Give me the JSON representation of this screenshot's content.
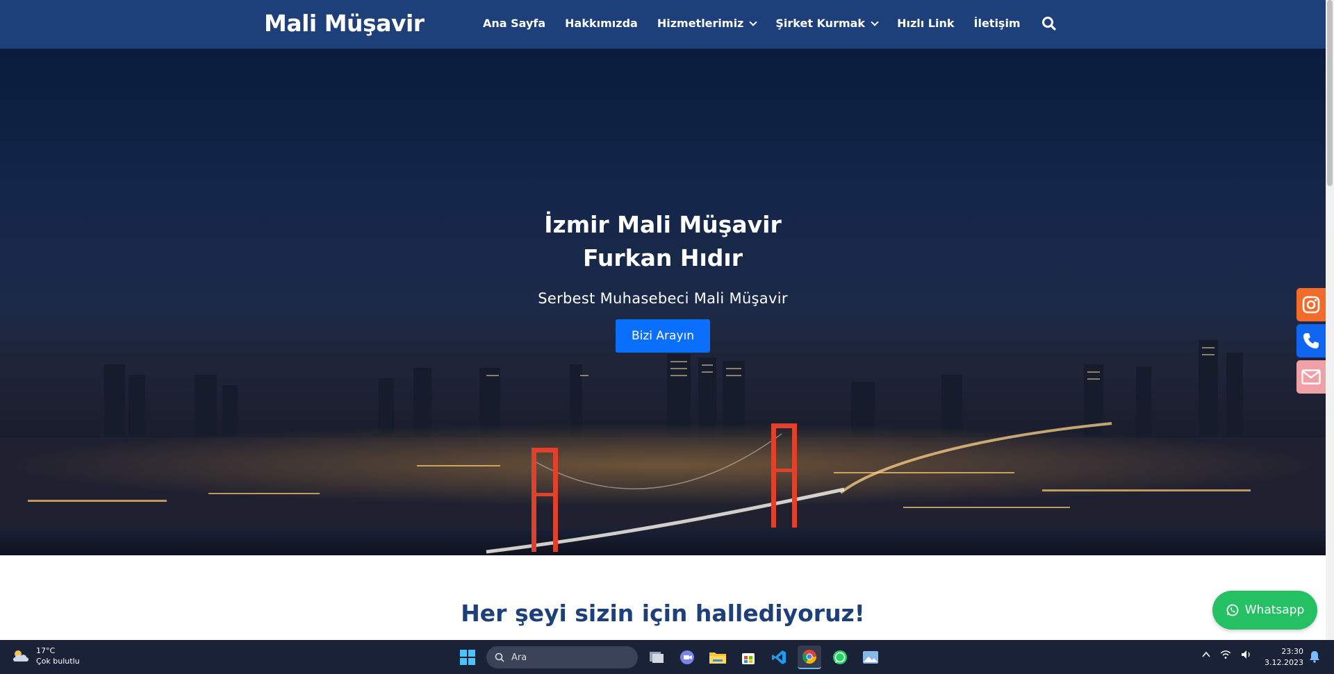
{
  "nav": {
    "brand": "Mali Müşavir",
    "items": [
      {
        "label": "Ana Sayfa"
      },
      {
        "label": "Hakkımızda"
      },
      {
        "label": "Hizmetlerimiz"
      },
      {
        "label": "Şirket Kurmak"
      },
      {
        "label": "Hızlı Link"
      },
      {
        "label": "İletişim"
      }
    ],
    "search_icon": "search-icon"
  },
  "hero": {
    "title_line1": "İzmir Mali Müşavir",
    "title_line2": "Furkan Hıdır",
    "subtitle": "Serbest Muhasebeci Mali Müşavir",
    "button_label": "Bizi Arayın"
  },
  "social": [
    {
      "icon": "instagram-icon",
      "color": "#f26b2a"
    },
    {
      "icon": "phone-icon",
      "color": "#1066f0"
    },
    {
      "icon": "mail-icon",
      "color": "#f0a1a8"
    }
  ],
  "section": {
    "title": "Her şeyi sizin için hallediyoruz!"
  },
  "whatsapp": {
    "label": "Whatsapp",
    "color": "#26c064"
  },
  "taskbar": {
    "weather_temp": "17°C",
    "weather_desc": "Çok bulutlu",
    "search_placeholder": "Ara",
    "apps": [
      "files-icon",
      "teams-icon",
      "file-explorer-icon",
      "store-icon",
      "vscode-icon",
      "chrome-icon",
      "whatsapp-icon",
      "photos-icon"
    ],
    "time": "23:30",
    "date": "3.12.2023"
  },
  "colors": {
    "navbar": "#1d3f7a",
    "primary_button": "#0b6ffd",
    "heading": "#1d3f7a"
  }
}
